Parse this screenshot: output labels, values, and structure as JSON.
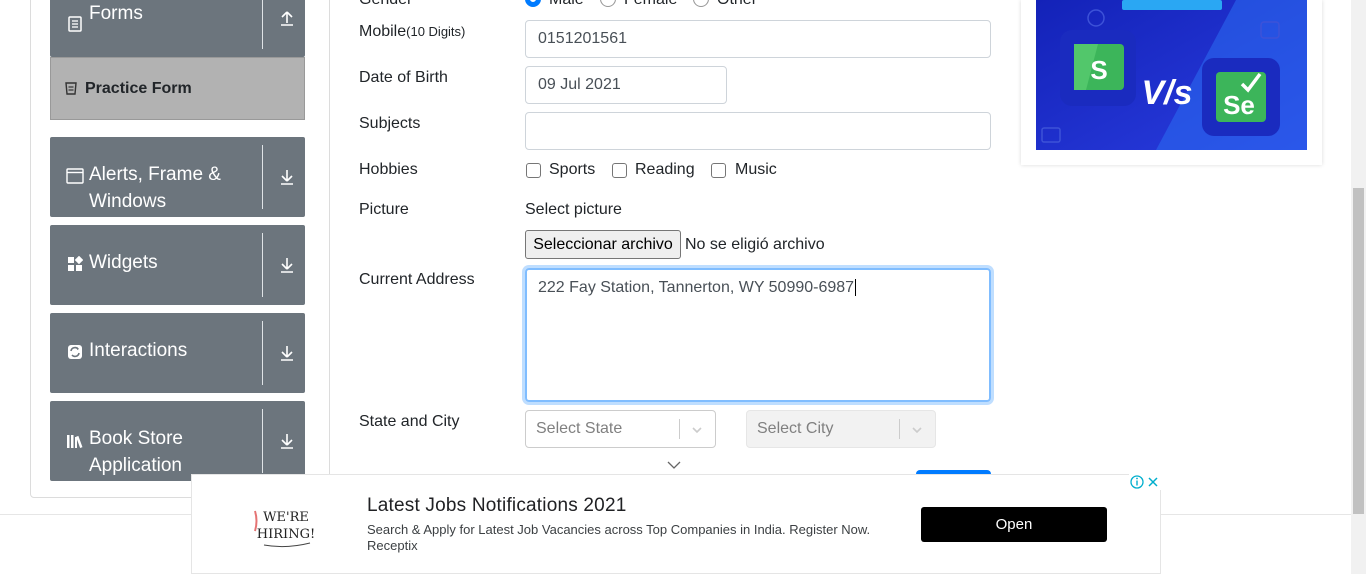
{
  "sidebar": {
    "groups": [
      {
        "title_line1": "Forms",
        "title_line2": "",
        "icon": "forms-icon"
      },
      {
        "title_line1": "Alerts, Frame &",
        "title_line2": "Windows",
        "icon": "window-icon"
      },
      {
        "title_line1": "Widgets",
        "title_line2": "",
        "icon": "widgets-icon"
      },
      {
        "title_line1": "Interactions",
        "title_line2": "",
        "icon": "interactions-icon"
      },
      {
        "title_line1": "Book Store",
        "title_line2": "Application",
        "icon": "books-icon"
      }
    ],
    "active_item": "Practice Form"
  },
  "form": {
    "gender": {
      "label": "Gender",
      "options": [
        "Male",
        "Female",
        "Other"
      ],
      "selected": "Male"
    },
    "mobile": {
      "label": "Mobile",
      "hint": "(10 Digits)",
      "value": "0151201561"
    },
    "dob": {
      "label": "Date of Birth",
      "value": "09 Jul 2021"
    },
    "subjects": {
      "label": "Subjects",
      "value": ""
    },
    "hobbies": {
      "label": "Hobbies",
      "options": [
        "Sports",
        "Reading",
        "Music"
      ]
    },
    "picture": {
      "label": "Picture",
      "select_text": "Select picture",
      "button": "Seleccionar archivo",
      "status": "No se eligió archivo"
    },
    "address": {
      "label": "Current Address",
      "value": "222 Fay Station, Tannerton, WY 50990-6987"
    },
    "state_city": {
      "label": "State and City",
      "state_placeholder": "Select State",
      "city_placeholder": "Select City"
    }
  },
  "ad": {
    "headline": "Latest Jobs Notifications 2021",
    "description": "Search & Apply for Latest Job Vacancies across Top Companies in India. Register Now.",
    "advertiser": "Receptix",
    "cta": "Open",
    "hiring_line1": "WE'RE",
    "hiring_line2": "HIRING!"
  },
  "colors": {
    "sidebar": "#6c757d",
    "active": "#b2b2b2",
    "primary": "#007bff"
  }
}
